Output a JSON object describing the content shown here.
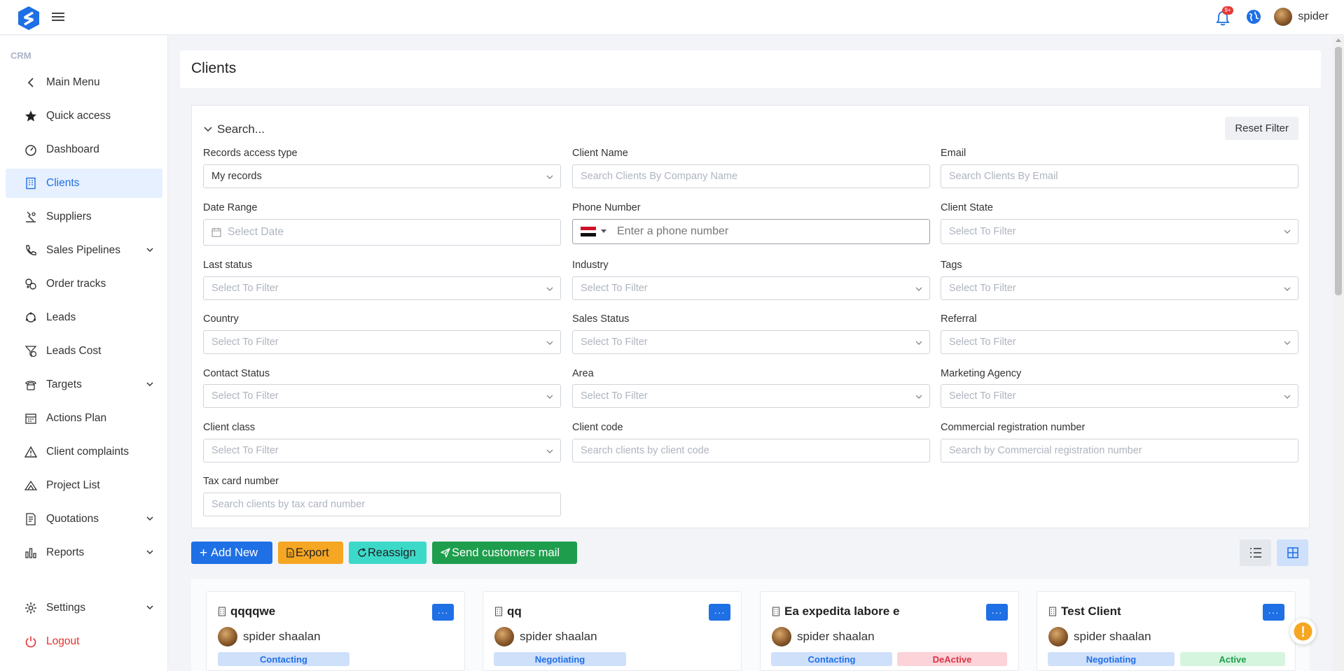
{
  "header": {
    "notif_badge": "9+",
    "username": "spider"
  },
  "sidebar": {
    "section": "CRM",
    "items": [
      {
        "label": "Main Menu",
        "icon": "chevron-left-icon"
      },
      {
        "label": "Quick access",
        "icon": "star-icon"
      },
      {
        "label": "Dashboard",
        "icon": "gauge-icon"
      },
      {
        "label": "Clients",
        "icon": "building-icon"
      },
      {
        "label": "Suppliers",
        "icon": "supplier-icon"
      },
      {
        "label": "Sales Pipelines",
        "icon": "phone-icon"
      },
      {
        "label": "Order tracks",
        "icon": "order-track-icon"
      },
      {
        "label": "Leads",
        "icon": "leads-icon"
      },
      {
        "label": "Leads Cost",
        "icon": "leads-cost-icon"
      },
      {
        "label": "Targets",
        "icon": "target-phone-icon"
      },
      {
        "label": "Actions Plan",
        "icon": "calendar-icon"
      },
      {
        "label": "Client complaints",
        "icon": "warning-icon"
      },
      {
        "label": "Project List",
        "icon": "project-icon"
      },
      {
        "label": "Quotations",
        "icon": "quotation-icon"
      },
      {
        "label": "Reports",
        "icon": "bar-chart-icon"
      },
      {
        "label": "Settings",
        "icon": "gear-icon"
      },
      {
        "label": "Logout",
        "icon": "power-icon"
      }
    ]
  },
  "page": {
    "title": "Clients"
  },
  "filters": {
    "search_label": "Search...",
    "reset_label": "Reset Filter",
    "records_access_type": {
      "label": "Records access type",
      "value": "My records"
    },
    "client_name": {
      "label": "Client Name",
      "placeholder": "Search Clients By Company Name"
    },
    "email": {
      "label": "Email",
      "placeholder": "Search Clients By Email"
    },
    "date_range": {
      "label": "Date Range",
      "placeholder": "Select Date"
    },
    "phone_number": {
      "label": "Phone Number",
      "placeholder": "Enter a phone number"
    },
    "client_state": {
      "label": "Client State",
      "placeholder": "Select To Filter"
    },
    "last_status": {
      "label": "Last status",
      "placeholder": "Select To Filter"
    },
    "industry": {
      "label": "Industry",
      "placeholder": "Select To Filter"
    },
    "tags": {
      "label": "Tags",
      "placeholder": "Select To Filter"
    },
    "country": {
      "label": "Country",
      "placeholder": "Select To Filter"
    },
    "sales_status": {
      "label": "Sales Status",
      "placeholder": "Select To Filter"
    },
    "referral": {
      "label": "Referral",
      "placeholder": "Select To Filter"
    },
    "contact_status": {
      "label": "Contact Status",
      "placeholder": "Select To Filter"
    },
    "area": {
      "label": "Area",
      "placeholder": "Select To Filter"
    },
    "marketing_agency": {
      "label": "Marketing Agency",
      "placeholder": "Select To Filter"
    },
    "client_class": {
      "label": "Client class",
      "placeholder": "Select To Filter"
    },
    "client_code": {
      "label": "Client code",
      "placeholder": "Search clients by client code"
    },
    "commercial_registration": {
      "label": "Commercial registration number",
      "placeholder": "Search by Commercial registration number"
    },
    "tax_card": {
      "label": "Tax card number",
      "placeholder": "Search clients by tax card number"
    }
  },
  "actions": {
    "add_new": "Add New",
    "export": "Export",
    "reassign": "Reassign",
    "send_mail": "Send customers mail"
  },
  "clients": [
    {
      "name": "qqqqwe",
      "owner": "spider shaalan",
      "badges": [
        {
          "text": "Contacting",
          "tone": "blue"
        }
      ]
    },
    {
      "name": "qq",
      "owner": "spider shaalan",
      "badges": [
        {
          "text": "Negotiating",
          "tone": "blue"
        }
      ]
    },
    {
      "name": "Ea expedita labore e",
      "owner": "spider shaalan",
      "badges": [
        {
          "text": "Contacting",
          "tone": "blue"
        },
        {
          "text": "DeActive",
          "tone": "red"
        }
      ]
    },
    {
      "name": "Test Client",
      "owner": "spider shaalan",
      "badges": [
        {
          "text": "Negotiating",
          "tone": "blue"
        },
        {
          "text": "Active",
          "tone": "green"
        }
      ]
    }
  ],
  "more_label": "···",
  "colors": {
    "primary": "#1f6fe5",
    "warning": "#f5a623",
    "info": "#3cd9c9",
    "success": "#1e9e4d",
    "danger": "#e5302e"
  }
}
